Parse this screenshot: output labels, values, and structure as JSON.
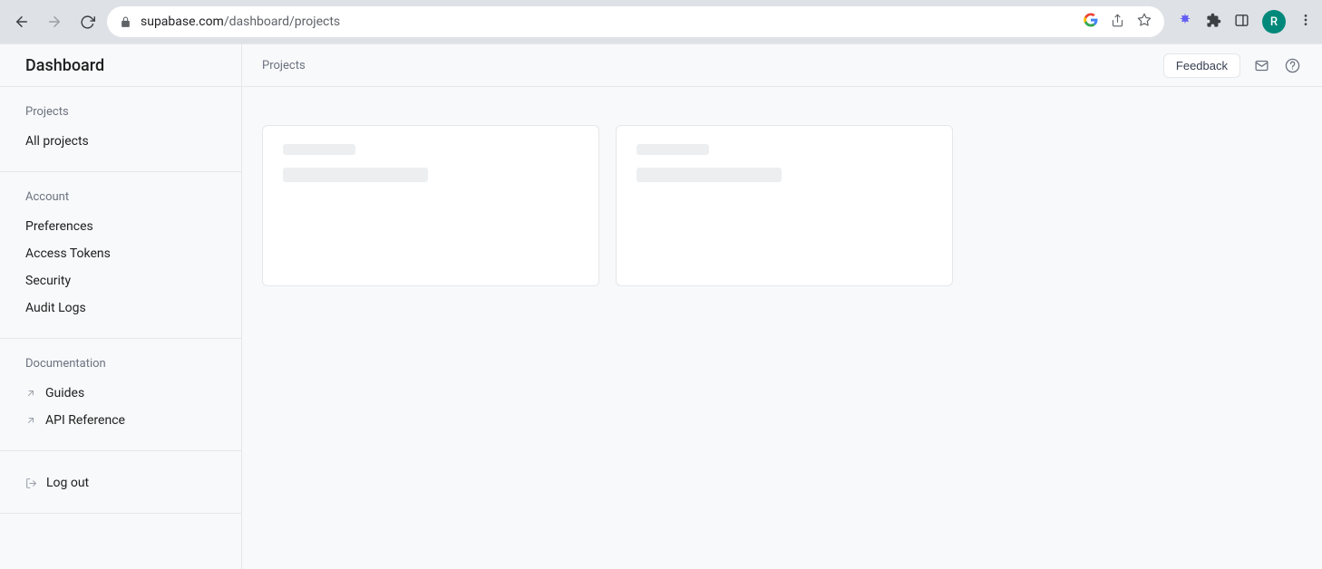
{
  "browser": {
    "url_host": "supabase.com",
    "url_path": "/dashboard/projects",
    "avatar_initial": "R"
  },
  "sidebar": {
    "title": "Dashboard",
    "sections": {
      "projects": {
        "heading": "Projects",
        "items": [
          {
            "label": "All projects"
          }
        ]
      },
      "account": {
        "heading": "Account",
        "items": [
          {
            "label": "Preferences"
          },
          {
            "label": "Access Tokens"
          },
          {
            "label": "Security"
          },
          {
            "label": "Audit Logs"
          }
        ]
      },
      "documentation": {
        "heading": "Documentation",
        "items": [
          {
            "label": "Guides"
          },
          {
            "label": "API Reference"
          }
        ]
      },
      "logout": {
        "label": "Log out"
      }
    }
  },
  "header": {
    "breadcrumb": "Projects",
    "feedback_label": "Feedback"
  },
  "main": {
    "project_cards": [
      {
        "loading": true
      },
      {
        "loading": true
      }
    ]
  }
}
